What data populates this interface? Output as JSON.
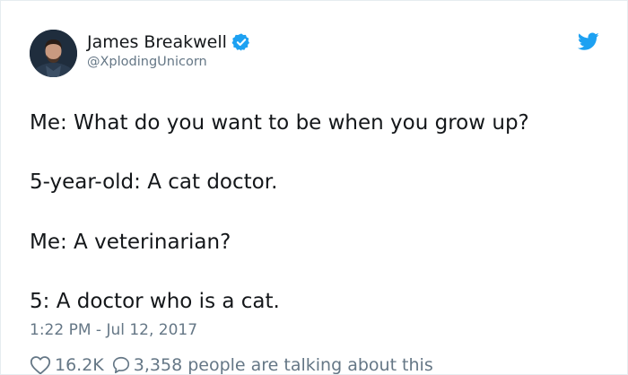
{
  "author": {
    "display_name": "James Breakwell",
    "handle": "@XplodingUnicorn",
    "verified": true
  },
  "tweet": {
    "lines": [
      "Me: What do you want to be when you grow up?",
      "5-year-old: A cat doctor.",
      "Me: A veterinarian?",
      "5: A doctor who is a cat."
    ],
    "timestamp": "1:22 PM - Jul 12, 2017"
  },
  "engagement": {
    "like_count": "16.2K",
    "conversation_text": "3,358 people are talking about this"
  },
  "icons": {
    "verified": "verified-badge-icon",
    "brand": "twitter-bird-icon",
    "like": "heart-icon",
    "reply": "speech-bubble-icon"
  },
  "colors": {
    "brand_blue": "#1da1f2",
    "text_primary": "#14171a",
    "text_secondary": "#657786",
    "border": "#e6ecf0"
  }
}
